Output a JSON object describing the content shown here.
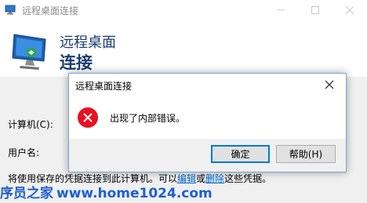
{
  "window": {
    "title": "远程桌面连接"
  },
  "banner": {
    "line1": "远程桌面",
    "line2": "连接"
  },
  "form": {
    "computer_label": "计算机(C):",
    "username_label": "用户名:",
    "saved_text_prefix": "将使用保存的凭据连接到此计算机。可以",
    "edit_link": "编辑",
    "or_text": "或",
    "delete_link": "删除",
    "saved_text_suffix": "这些凭据。"
  },
  "dialog": {
    "title": "远程桌面连接",
    "message": "出现了内部错误。",
    "ok_label": "确定",
    "help_label": "帮助(H)"
  },
  "watermark": {
    "text": "序员之家",
    "url": "www.home1024.com"
  },
  "colors": {
    "accent": "#0078d7",
    "banner_text": "#1a3d6e",
    "error_red": "#e81123",
    "link": "#0066cc",
    "watermark": "#1d5fd1"
  },
  "icons": {
    "app": "remote-desktop-icon",
    "error": "error-x-icon",
    "close": "close-icon"
  }
}
